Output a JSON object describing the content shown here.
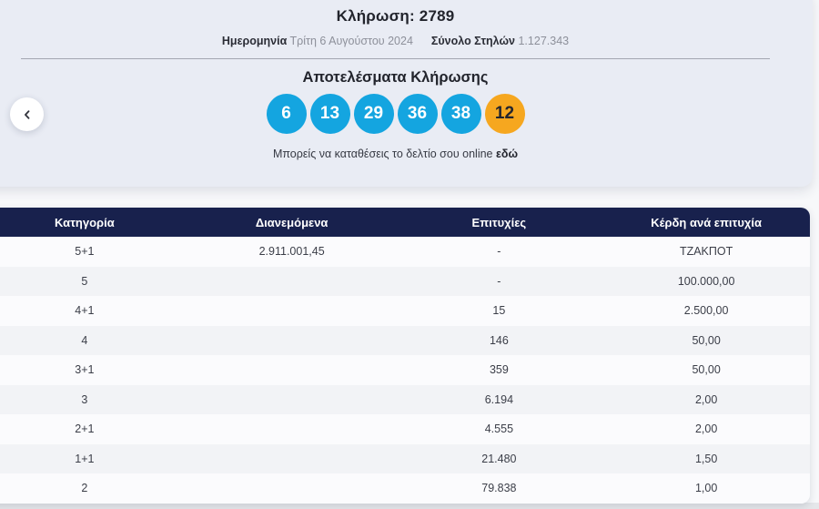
{
  "draw": {
    "title": "Κλήρωση: 2789",
    "date_label": "Ημερομηνία",
    "date_value": "Τρίτη 6 Αυγούστου 2024",
    "total_columns_label": "Σύνολο Στηλών",
    "total_columns_value": "1.127.343"
  },
  "results": {
    "title": "Αποτελέσματα Κλήρωσης",
    "numbers": [
      "6",
      "13",
      "29",
      "36",
      "38",
      "12"
    ],
    "deposit_text": "Μπορείς να καταθέσεις το δελτίο σου online",
    "deposit_link": "εδώ"
  },
  "table": {
    "headers": [
      "Κατηγορία",
      "Διανεμόμενα",
      "Επιτυχίες",
      "Κέρδη ανά επιτυχία"
    ],
    "rows": [
      [
        "5+1",
        "2.911.001,45",
        "-",
        "ΤΖΑΚΠΟΤ"
      ],
      [
        "5",
        "",
        "-",
        "100.000,00"
      ],
      [
        "4+1",
        "",
        "15",
        "2.500,00"
      ],
      [
        "4",
        "",
        "146",
        "50,00"
      ],
      [
        "3+1",
        "",
        "359",
        "50,00"
      ],
      [
        "3",
        "",
        "6.194",
        "2,00"
      ],
      [
        "2+1",
        "",
        "4.555",
        "2,00"
      ],
      [
        "1+1",
        "",
        "21.480",
        "1,50"
      ],
      [
        "2",
        "",
        "79.838",
        "1,00"
      ]
    ]
  },
  "colors": {
    "ball_blue": "#14a5e0",
    "ball_joker_orange": "#f6a71f",
    "table_header_navy": "#18214d",
    "card_background": "#e9ecf4"
  }
}
